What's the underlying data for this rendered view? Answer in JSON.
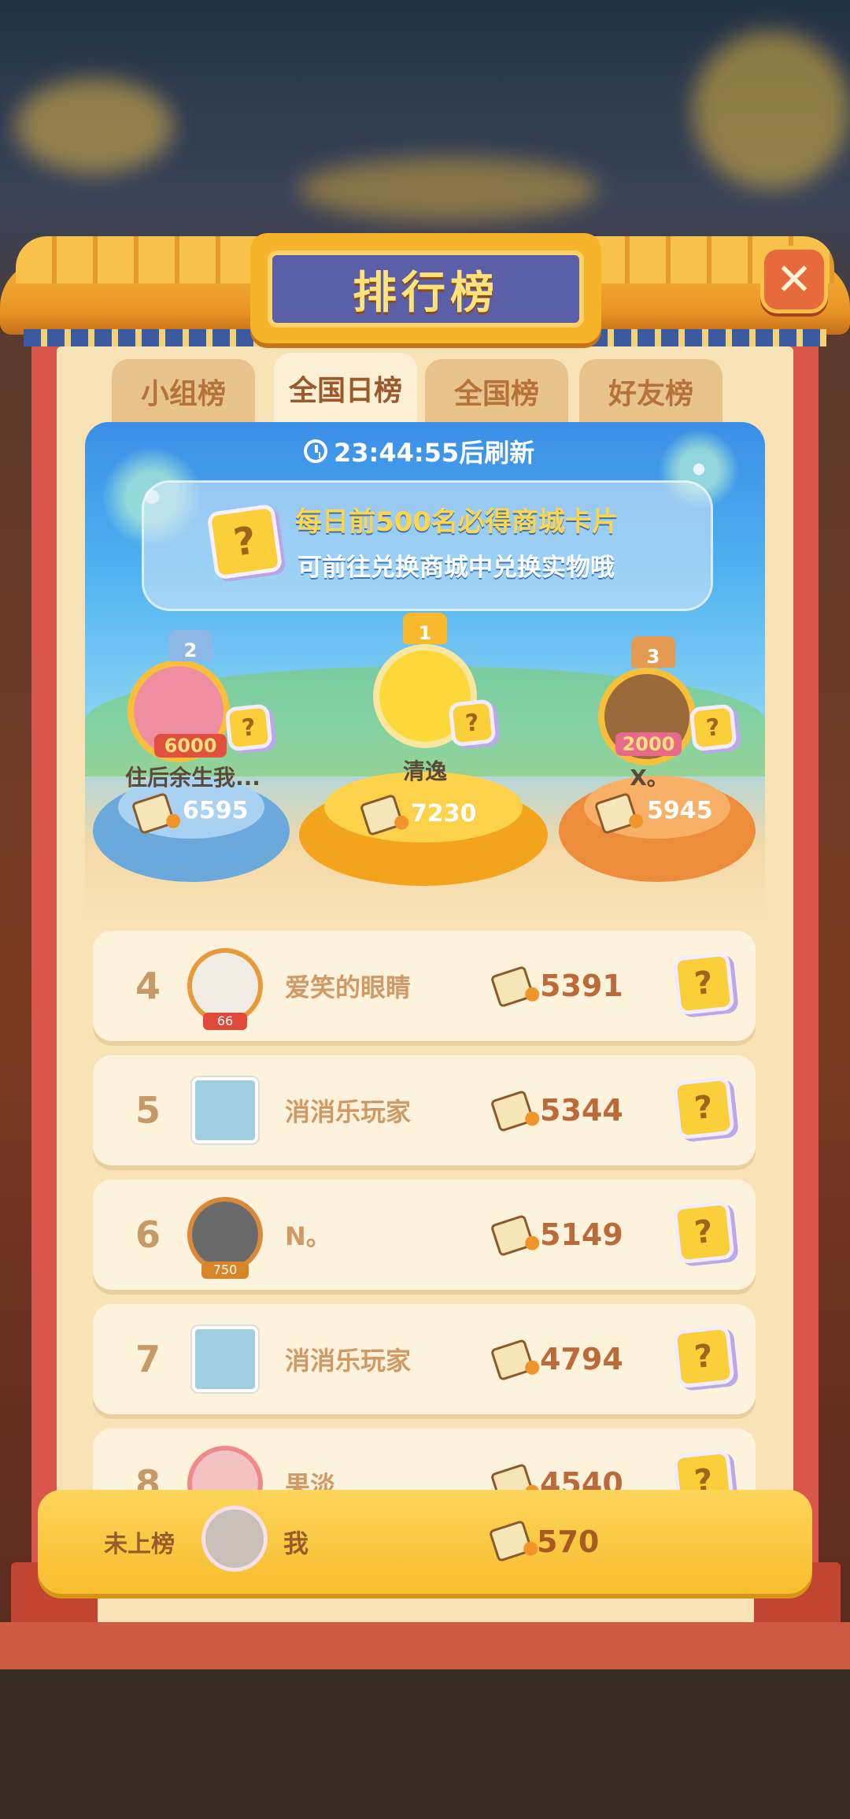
{
  "title": "排行榜",
  "close_label": "✕",
  "tabs": [
    {
      "label": "小组榜",
      "active": false
    },
    {
      "label": "全国日榜",
      "active": true
    },
    {
      "label": "全国榜",
      "active": false
    },
    {
      "label": "好友榜",
      "active": false
    }
  ],
  "timer": "23:44:55后刷新",
  "banner": {
    "line1": "每日前500名必得商城卡片",
    "line2": "可前往兑换商城中兑换实物哦",
    "icon": "question-card-icon"
  },
  "podium": [
    {
      "rank": "1",
      "name": "清逸",
      "score": "7230",
      "color": "#f8b92c"
    },
    {
      "rank": "2",
      "name": "住后余生我...",
      "score": "6595",
      "badge": "6000",
      "color": "#6fb0e0"
    },
    {
      "rank": "3",
      "name": "X。",
      "score": "5945",
      "badge": "2000",
      "color": "#f19d52"
    }
  ],
  "rows": [
    {
      "rank": "4",
      "name": "爱笑的眼睛",
      "score": "5391",
      "avatar_badge": "66"
    },
    {
      "rank": "5",
      "name": "消消乐玩家",
      "score": "5344"
    },
    {
      "rank": "6",
      "name": "N。",
      "score": "5149",
      "avatar_badge": "750"
    },
    {
      "rank": "7",
      "name": "消消乐玩家",
      "score": "4794"
    },
    {
      "rank": "8",
      "name": "果淡",
      "score": "4540"
    }
  ],
  "me": {
    "rank_label": "未上榜",
    "name": "我",
    "score": "570"
  },
  "colors": {
    "frame": "#d9574a",
    "roof": "#f6b23a",
    "plaque": "#5b5fa8",
    "score_text": "#bb6a3a"
  },
  "reward_symbol": "?"
}
